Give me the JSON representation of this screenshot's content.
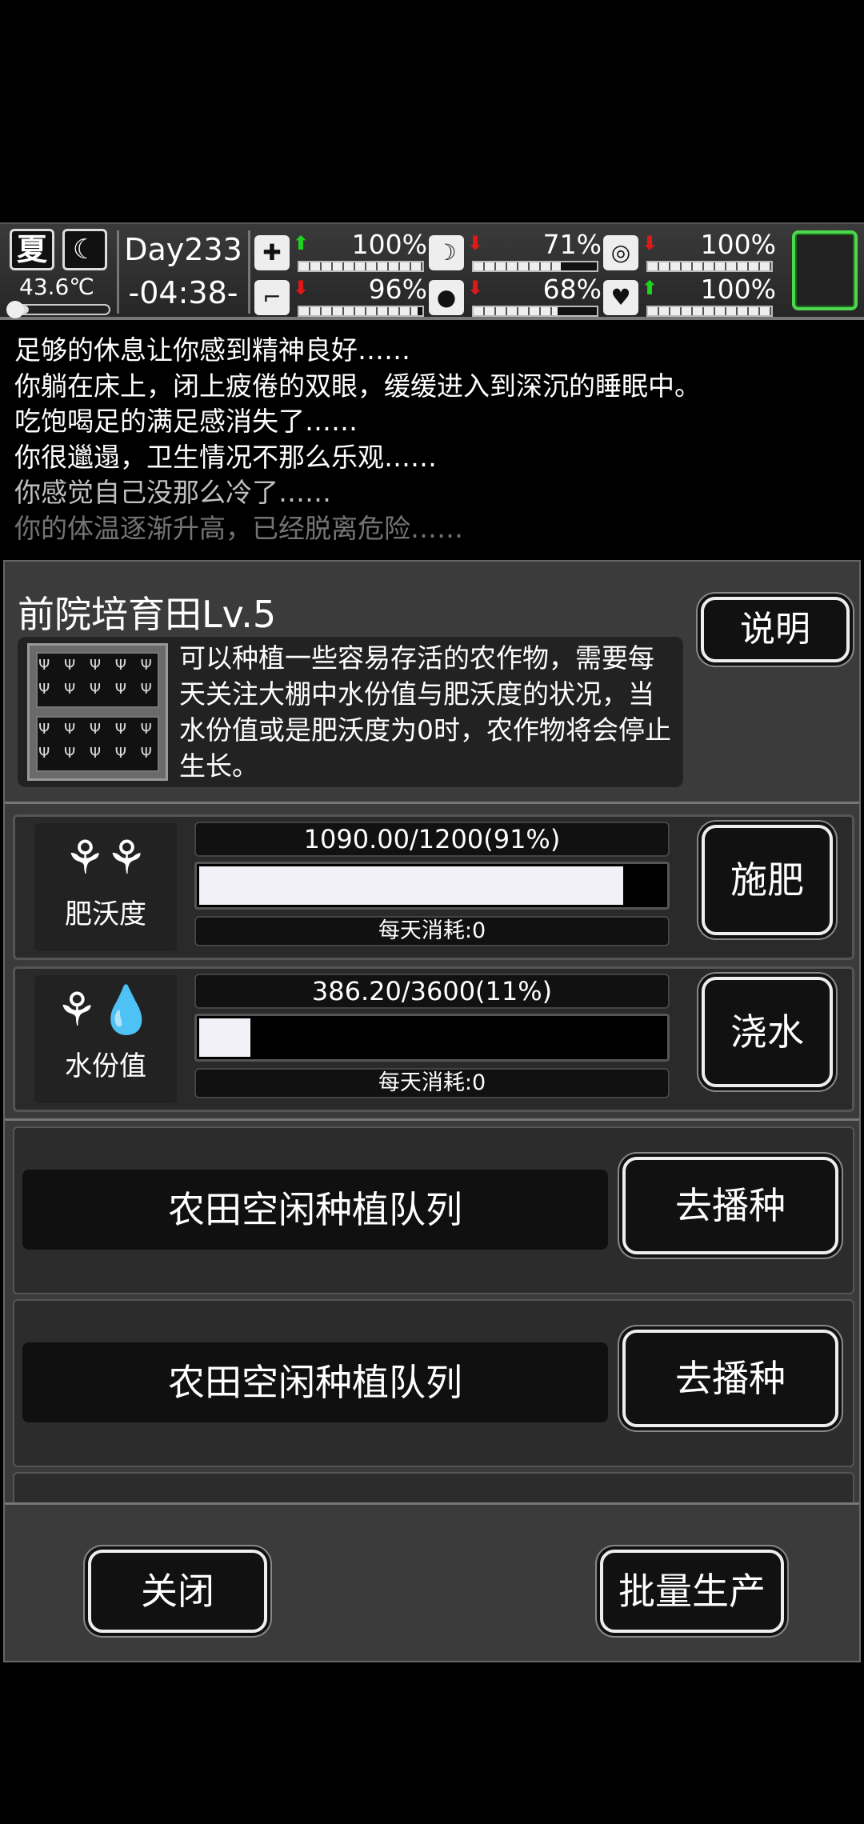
{
  "status": {
    "season": "夏",
    "night_icon": "moon-icon",
    "temperature": "43.6℃",
    "temperature_level": 0.18,
    "day": "Day233",
    "time": "-04:38-",
    "stats": [
      {
        "name": "health",
        "icon": "medkit-icon",
        "trend": "up",
        "value": "100%",
        "level": 1.0
      },
      {
        "name": "hunger",
        "icon": "stomach-icon",
        "trend": "down",
        "value": "71%",
        "level": 0.71
      },
      {
        "name": "sanity",
        "icon": "capsule-icon",
        "trend": "down",
        "value": "100%",
        "level": 1.0
      },
      {
        "name": "stamina",
        "icon": "boot-icon",
        "trend": "down",
        "value": "96%",
        "level": 0.96
      },
      {
        "name": "thirst",
        "icon": "water-drop-icon",
        "trend": "down",
        "value": "68%",
        "level": 0.68
      },
      {
        "name": "mood",
        "icon": "heart-icon",
        "trend": "up",
        "value": "100%",
        "level": 1.0
      }
    ]
  },
  "log": [
    "足够的休息让你感到精神良好……",
    "你躺在床上，闭上疲倦的双眼，缓缓进入到深沉的睡眠中。",
    "吃饱喝足的满足感消失了……",
    "你很邋遢，卫生情况不那么乐观……",
    "你感觉自己没那么冷了……",
    "你的体温逐渐升高，已经脱离危险……"
  ],
  "panel": {
    "title": "前院培育田Lv.5",
    "help_label": "说明",
    "description": "可以种植一些容易存活的农作物，需要每天关注大棚中水份值与肥沃度的状况，当水份值或是肥沃度为0时，农作物将会停止生长。",
    "fertility": {
      "label": "肥沃度",
      "value_text": "1090.00/1200(91%)",
      "level": 0.91,
      "consumption": "每天消耗:0",
      "action_label": "施肥"
    },
    "water": {
      "label": "水份值",
      "value_text": "386.20/3600(11%)",
      "level": 0.11,
      "consumption": "每天消耗:0",
      "action_label": "浇水"
    },
    "queues": [
      {
        "label": "农田空闲种植队列",
        "action_label": "去播种"
      },
      {
        "label": "农田空闲种植队列",
        "action_label": "去播种"
      }
    ],
    "close_label": "关闭",
    "batch_label": "批量生产"
  },
  "colors": {
    "accent_green": "#4fd64f",
    "trend_up": "#1ed21e",
    "trend_down": "#e01818"
  }
}
